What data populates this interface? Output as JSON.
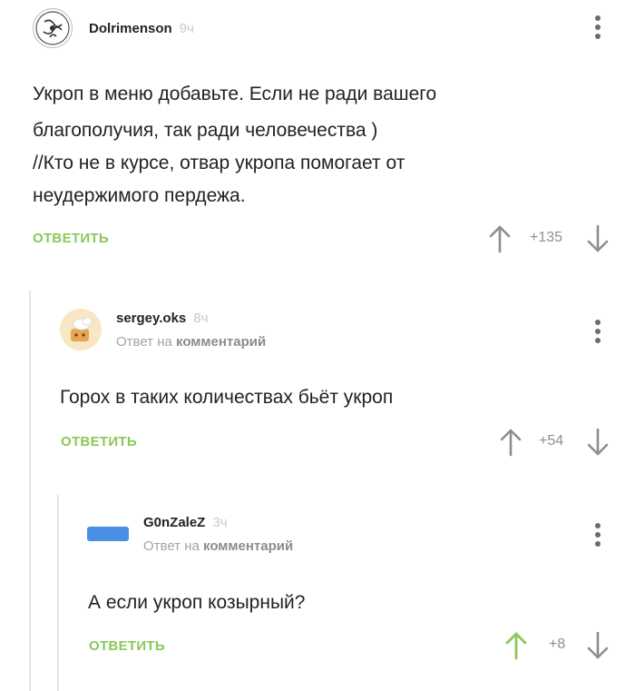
{
  "colors": {
    "accent_green": "#8ac858",
    "thread_line": "#e4e4e4",
    "muted": "#a3a3a3"
  },
  "comments": [
    {
      "username": "Dolrimenson",
      "time": "9ч",
      "text_lines": [
        "Укроп в меню добавьте. Если не ради вашего",
        "благополучия, так ради человечества )",
        "//Кто не в курсе, отвар укропа помогает от",
        "неудержимого пердежа."
      ],
      "reply_label": "ОТВЕТИТЬ",
      "score": "+135",
      "upvoted": false
    },
    {
      "username": "sergey.oks",
      "time": "8ч",
      "reply_to_prefix": "Ответ на",
      "reply_to_link": "комментарий",
      "text_lines": [
        "Горох в таких количествах бьёт укроп"
      ],
      "reply_label": "ОТВЕТИТЬ",
      "score": "+54",
      "upvoted": false
    },
    {
      "username": "G0nZaleZ",
      "time": "3ч",
      "reply_to_prefix": "Ответ на",
      "reply_to_link": "комментарий",
      "text_lines": [
        "А если укроп козырный?"
      ],
      "reply_label": "ОТВЕТИТЬ",
      "score": "+8",
      "upvoted": true
    }
  ]
}
